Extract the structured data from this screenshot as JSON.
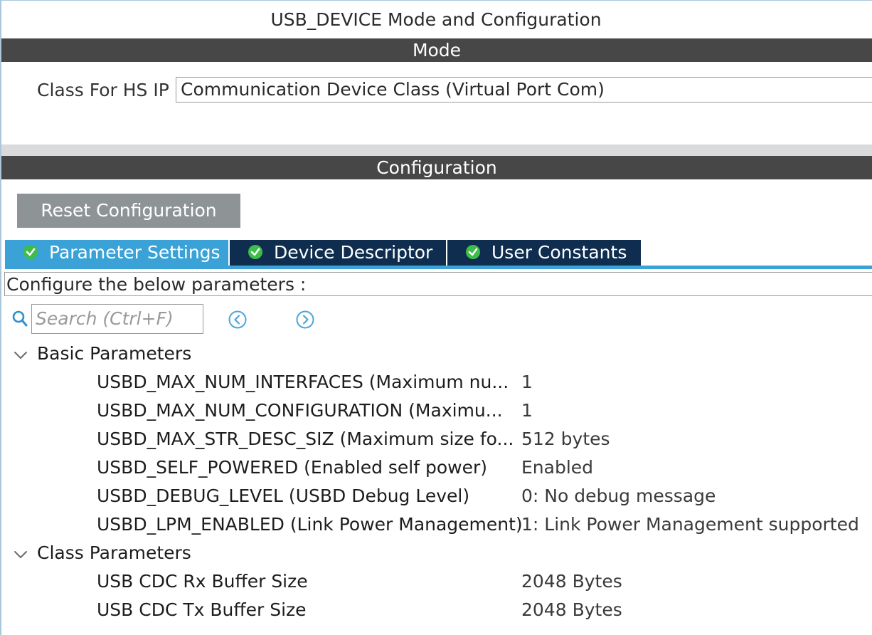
{
  "panel": {
    "title": "USB_DEVICE Mode and Configuration"
  },
  "mode": {
    "header": "Mode",
    "class_label": "Class For HS IP",
    "class_value": "Communication Device Class (Virtual Port Com)"
  },
  "configuration": {
    "header": "Configuration",
    "reset_label": "Reset Configuration",
    "tabs": [
      {
        "label": "Parameter Settings",
        "status_icon": "check-circle-icon",
        "active": true
      },
      {
        "label": "Device Descriptor",
        "status_icon": "check-circle-icon",
        "active": false
      },
      {
        "label": "User Constants",
        "status_icon": "check-circle-icon",
        "active": false
      }
    ],
    "hint": "Configure the below parameters :",
    "search": {
      "placeholder": "Search (Ctrl+F)"
    },
    "groups": [
      {
        "label": "Basic Parameters",
        "params": [
          {
            "name": "USBD_MAX_NUM_INTERFACES (Maximum nu...",
            "value": "1"
          },
          {
            "name": "USBD_MAX_NUM_CONFIGURATION (Maximu...",
            "value": "1"
          },
          {
            "name": "USBD_MAX_STR_DESC_SIZ (Maximum size fo...",
            "value": "512 bytes"
          },
          {
            "name": "USBD_SELF_POWERED (Enabled self power)",
            "value": "Enabled"
          },
          {
            "name": "USBD_DEBUG_LEVEL (USBD Debug Level)",
            "value": "0: No debug message"
          },
          {
            "name": "USBD_LPM_ENABLED (Link Power Management)",
            "value": "1: Link Power Management supported"
          }
        ]
      },
      {
        "label": "Class Parameters",
        "params": [
          {
            "name": "USB CDC Rx Buffer Size",
            "value": "2048 Bytes"
          },
          {
            "name": "USB CDC Tx Buffer Size",
            "value": "2048 Bytes"
          }
        ]
      }
    ]
  },
  "colors": {
    "section_bar": "#474747",
    "active_tab": "#3aa2d6",
    "inactive_tab": "#0f2d4f",
    "status_ok": "#3fbd4a",
    "reset_button": "#8e9396"
  }
}
